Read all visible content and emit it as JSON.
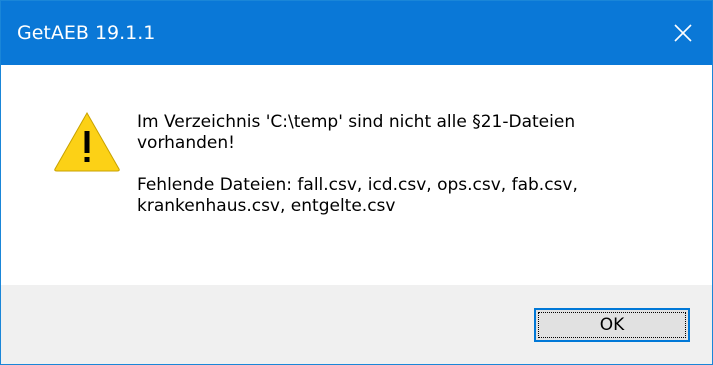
{
  "window": {
    "title": "GetAEB 19.1.1",
    "accent_color": "#0a78d7"
  },
  "dialog": {
    "icon": "warning-icon",
    "message_line1": "Im Verzeichnis 'C:\\temp' sind nicht alle §21-Dateien\nvorhanden!",
    "message_line2": "Fehlende Dateien: fall.csv, icd.csv, ops.csv, fab.csv,\nkrankenhaus.csv, entgelte.csv",
    "ok_label": "OK"
  }
}
